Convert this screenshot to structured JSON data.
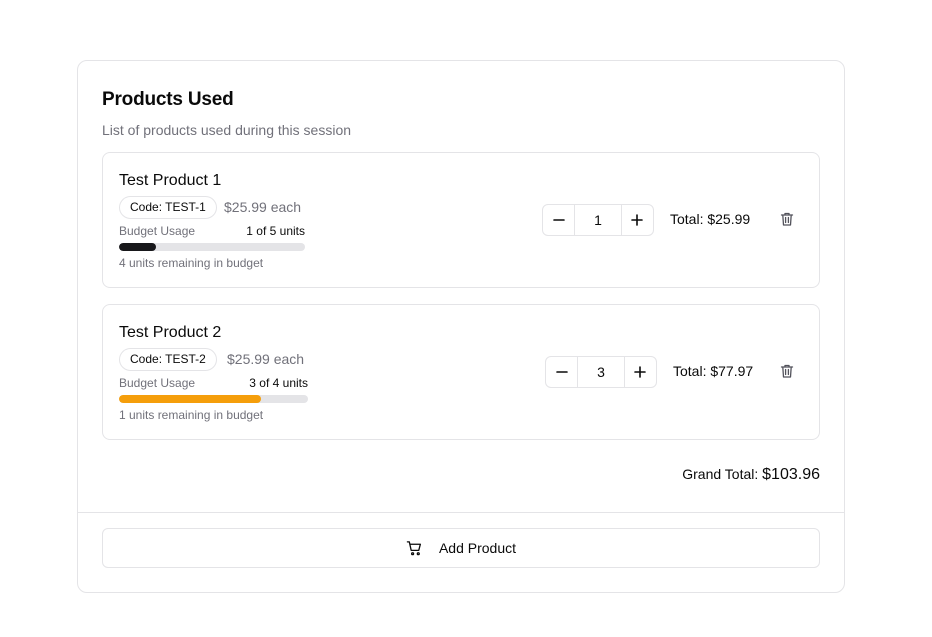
{
  "card": {
    "title": "Products Used",
    "description": "List of products used during this session"
  },
  "items": [
    {
      "name": "Test Product 1",
      "code": "Code: TEST-1",
      "price": "$25.99 each",
      "budget_label": "Budget Usage",
      "budget_count": "1 of 5 units",
      "budget_used_fraction": 0.2,
      "budget_color": "#18181b",
      "remaining": "4 units remaining in budget",
      "quantity": "1",
      "total": "Total: $25.99"
    },
    {
      "name": "Test Product 2",
      "code": "Code: TEST-2",
      "price": "$25.99 each",
      "budget_label": "Budget Usage",
      "budget_count": "3 of 4 units",
      "budget_used_fraction": 0.75,
      "budget_color": "#f59e0b",
      "remaining": "1 units remaining in budget",
      "quantity": "3",
      "total": "Total: $77.97"
    }
  ],
  "icons": {
    "decrement": "minus-icon",
    "increment": "plus-icon",
    "delete": "trash-icon",
    "add": "shopping-cart-icon"
  },
  "grand_total": {
    "label": "Grand Total: ",
    "value": "$103.96"
  },
  "add_button": {
    "label": "Add Product"
  }
}
